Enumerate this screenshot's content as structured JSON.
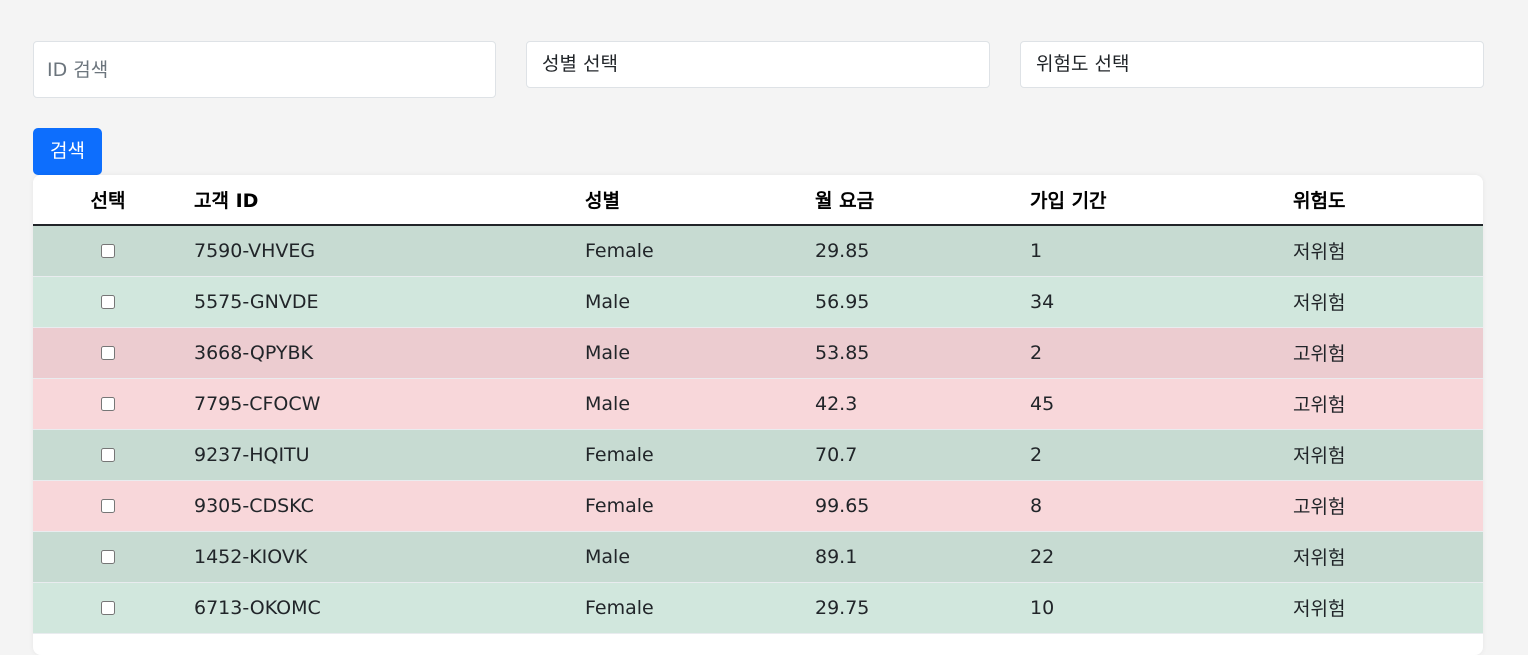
{
  "filters": {
    "id_placeholder": "ID 검색",
    "gender_select": "성별 선택",
    "risk_select": "위험도 선택",
    "search_button": "검색"
  },
  "table": {
    "headers": {
      "select": "선택",
      "customer_id": "고객 ID",
      "gender": "성별",
      "monthly_fee": "월 요금",
      "tenure": "가입 기간",
      "risk": "위험도"
    },
    "rows": [
      {
        "customer_id": "7590-VHVEG",
        "gender": "Female",
        "monthly_fee": "29.85",
        "tenure": "1",
        "risk": "저위험"
      },
      {
        "customer_id": "5575-GNVDE",
        "gender": "Male",
        "monthly_fee": "56.95",
        "tenure": "34",
        "risk": "저위험"
      },
      {
        "customer_id": "3668-QPYBK",
        "gender": "Male",
        "monthly_fee": "53.85",
        "tenure": "2",
        "risk": "고위험"
      },
      {
        "customer_id": "7795-CFOCW",
        "gender": "Male",
        "monthly_fee": "42.3",
        "tenure": "45",
        "risk": "고위험"
      },
      {
        "customer_id": "9237-HQITU",
        "gender": "Female",
        "monthly_fee": "70.7",
        "tenure": "2",
        "risk": "저위험"
      },
      {
        "customer_id": "9305-CDSKC",
        "gender": "Female",
        "monthly_fee": "99.65",
        "tenure": "8",
        "risk": "고위험"
      },
      {
        "customer_id": "1452-KIOVK",
        "gender": "Male",
        "monthly_fee": "89.1",
        "tenure": "22",
        "risk": "저위험"
      },
      {
        "customer_id": "6713-OKOMC",
        "gender": "Female",
        "monthly_fee": "29.75",
        "tenure": "10",
        "risk": "저위험"
      }
    ]
  },
  "colors": {
    "low_risk_row": "#d1e7dd",
    "high_risk_row": "#f8d7da",
    "primary_button": "#0d6efd"
  }
}
